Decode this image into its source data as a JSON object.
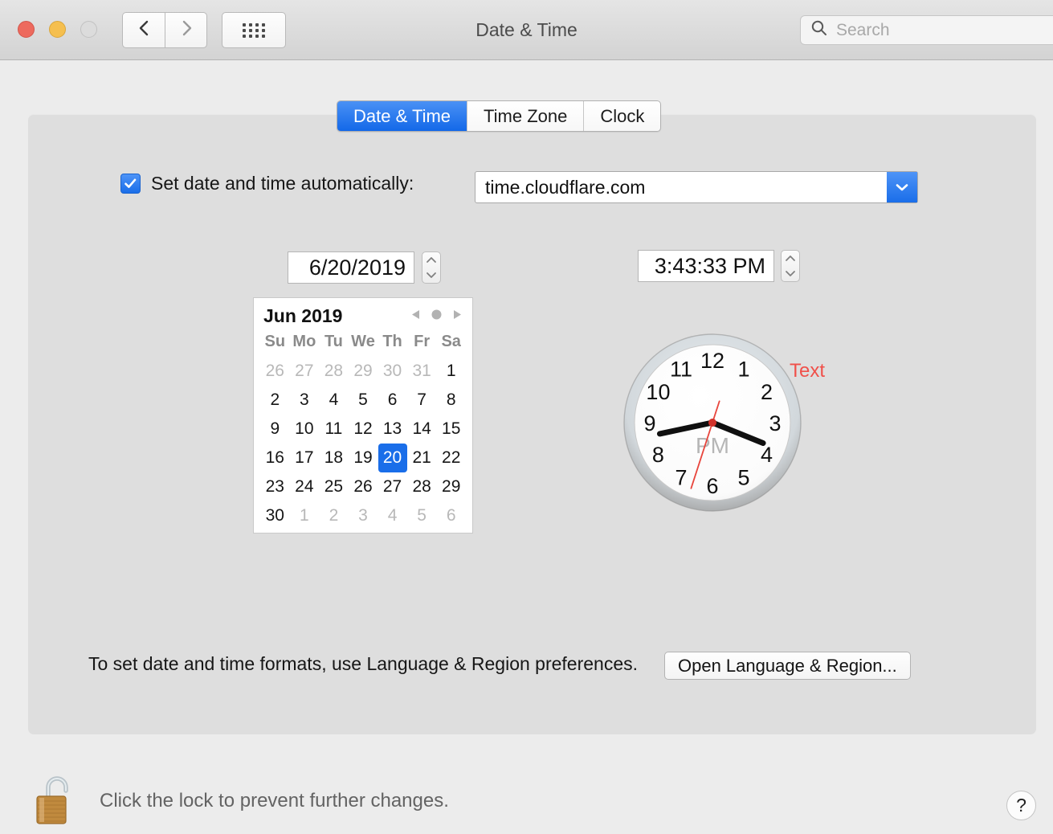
{
  "window": {
    "title": "Date & Time",
    "traffic_lights": [
      "close",
      "minimize",
      "zoom"
    ],
    "nav_back_icon": "chevron-left-icon",
    "nav_forward_icon": "chevron-right-icon",
    "show_all_icon": "grid-icon"
  },
  "search": {
    "placeholder": "Search",
    "value": "",
    "icon": "search-icon"
  },
  "tabs": [
    {
      "label": "Date & Time",
      "active": true
    },
    {
      "label": "Time Zone",
      "active": false
    },
    {
      "label": "Clock",
      "active": false
    }
  ],
  "auto": {
    "label": "Set date and time automatically:",
    "checked": true,
    "check_glyph": "✓",
    "server": "time.cloudflare.com",
    "dropdown_icon": "chevron-down-icon",
    "dropdown_color": "#1a6ee9"
  },
  "date": {
    "value": "6/20/2019",
    "stepper_up_icon": "chevron-up-icon",
    "stepper_down_icon": "chevron-down-icon"
  },
  "time": {
    "value": "3:43:33 PM",
    "stepper_up_icon": "chevron-up-icon",
    "stepper_down_icon": "chevron-down-icon"
  },
  "calendar": {
    "month_label": "Jun 2019",
    "prev_icon": "triangle-left-icon",
    "today_icon": "circle-icon",
    "next_icon": "triangle-right-icon",
    "weekdays": [
      "Su",
      "Mo",
      "Tu",
      "We",
      "Th",
      "Fr",
      "Sa"
    ],
    "selected_day": 20,
    "selection_color": "#1a6ee9",
    "weeks": [
      [
        {
          "n": "26",
          "muted": true
        },
        {
          "n": "27",
          "muted": true
        },
        {
          "n": "28",
          "muted": true
        },
        {
          "n": "29",
          "muted": true
        },
        {
          "n": "30",
          "muted": true
        },
        {
          "n": "31",
          "muted": true
        },
        {
          "n": "1",
          "muted": false
        }
      ],
      [
        {
          "n": "2",
          "muted": false
        },
        {
          "n": "3",
          "muted": false
        },
        {
          "n": "4",
          "muted": false
        },
        {
          "n": "5",
          "muted": false
        },
        {
          "n": "6",
          "muted": false
        },
        {
          "n": "7",
          "muted": false
        },
        {
          "n": "8",
          "muted": false
        }
      ],
      [
        {
          "n": "9",
          "muted": false
        },
        {
          "n": "10",
          "muted": false
        },
        {
          "n": "11",
          "muted": false
        },
        {
          "n": "12",
          "muted": false
        },
        {
          "n": "13",
          "muted": false
        },
        {
          "n": "14",
          "muted": false
        },
        {
          "n": "15",
          "muted": false
        }
      ],
      [
        {
          "n": "16",
          "muted": false
        },
        {
          "n": "17",
          "muted": false
        },
        {
          "n": "18",
          "muted": false
        },
        {
          "n": "19",
          "muted": false
        },
        {
          "n": "20",
          "muted": false,
          "selected": true
        },
        {
          "n": "21",
          "muted": false
        },
        {
          "n": "22",
          "muted": false
        }
      ],
      [
        {
          "n": "23",
          "muted": false
        },
        {
          "n": "24",
          "muted": false
        },
        {
          "n": "25",
          "muted": false
        },
        {
          "n": "26",
          "muted": false
        },
        {
          "n": "27",
          "muted": false
        },
        {
          "n": "28",
          "muted": false
        },
        {
          "n": "29",
          "muted": false
        }
      ],
      [
        {
          "n": "30",
          "muted": false
        },
        {
          "n": "1",
          "muted": true
        },
        {
          "n": "2",
          "muted": true
        },
        {
          "n": "3",
          "muted": true
        },
        {
          "n": "4",
          "muted": true
        },
        {
          "n": "5",
          "muted": true
        },
        {
          "n": "6",
          "muted": true
        }
      ]
    ]
  },
  "clock": {
    "numerals": [
      "12",
      "1",
      "2",
      "3",
      "4",
      "5",
      "6",
      "7",
      "8",
      "9",
      "10",
      "11"
    ],
    "meridiem": "PM",
    "annotation": "Text",
    "annotation_color": "#f0504a",
    "second_hand_color": "#e8453c",
    "hour_angle": 112,
    "minute_angle": 258,
    "second_angle": 198
  },
  "formats": {
    "note": "To set date and time formats, use Language & Region preferences.",
    "button_label": "Open Language & Region..."
  },
  "lock": {
    "icon": "unlocked-padlock-icon",
    "label": "Click the lock to prevent further changes."
  },
  "help": {
    "label": "?",
    "icon": "question-mark-icon"
  }
}
